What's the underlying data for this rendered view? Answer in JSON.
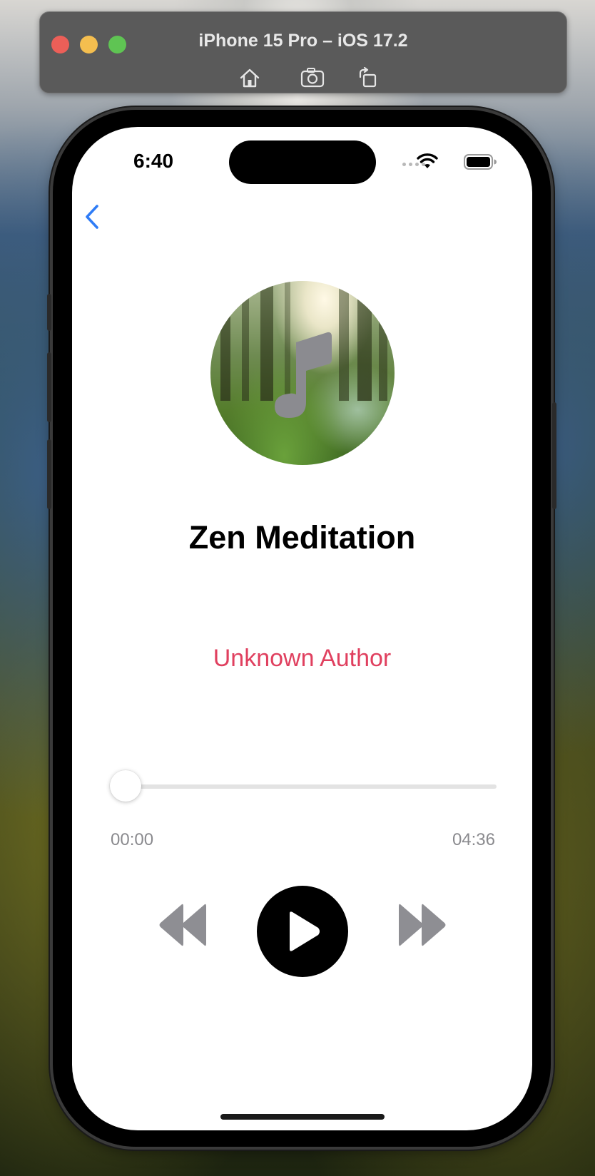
{
  "window": {
    "title": "iPhone 15 Pro – iOS 17.2",
    "toolbar": [
      "home-icon",
      "screenshot-icon",
      "rotate-icon"
    ]
  },
  "status_bar": {
    "time": "6:40",
    "icons": [
      "cellular-dots-icon",
      "wifi-icon",
      "battery-icon"
    ]
  },
  "nav": {
    "back_icon": "chevron-left-icon"
  },
  "player": {
    "artwork_icon": "music-note-icon",
    "title": "Zen Meditation",
    "author": "Unknown Author",
    "progress": 0,
    "elapsed": "00:00",
    "duration": "04:36",
    "controls": [
      "rewind-icon",
      "play-icon",
      "fast-forward-icon"
    ]
  },
  "colors": {
    "accent": "#2f7cf6",
    "author": "#e0405f",
    "secondary_text": "#8a8a8e",
    "control_gray": "#8e8e93"
  }
}
